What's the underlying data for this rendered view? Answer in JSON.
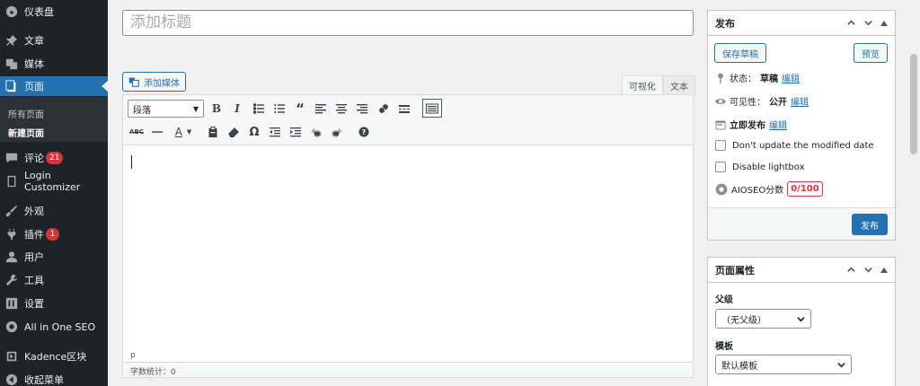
{
  "sidebar": {
    "items": [
      {
        "label": "仪表盘",
        "icon": "dashboard-icon"
      },
      {
        "label": "文章",
        "icon": "pin-icon"
      },
      {
        "label": "媒体",
        "icon": "media-icon"
      },
      {
        "label": "页面",
        "icon": "page-icon"
      },
      {
        "label": "评论",
        "icon": "comment-icon",
        "badge": "21"
      },
      {
        "label": "Login Customizer",
        "icon": "document-icon"
      },
      {
        "label": "外观",
        "icon": "appearance-icon"
      },
      {
        "label": "插件",
        "icon": "plugin-icon",
        "badge": "1"
      },
      {
        "label": "用户",
        "icon": "user-icon"
      },
      {
        "label": "工具",
        "icon": "wrench-icon"
      },
      {
        "label": "设置",
        "icon": "settings-icon"
      },
      {
        "label": "All in One SEO",
        "icon": "seo-icon"
      },
      {
        "label": "Kadence区块",
        "icon": "kadence-icon"
      },
      {
        "label": "收起菜单",
        "icon": "collapse-icon"
      }
    ],
    "submenu": [
      "所有页面",
      "新建页面"
    ],
    "accent": "#2271b1"
  },
  "editor": {
    "title_placeholder": "添加标题",
    "add_media_label": "添加媒体",
    "tab_visual": "可视化",
    "tab_text": "文本",
    "format_select": "段落",
    "status_path": "p",
    "word_count": "字数统计：0"
  },
  "publish": {
    "title": "发布",
    "save_draft": "保存草稿",
    "preview": "预览",
    "status_label": "状态：",
    "status_value": "草稿",
    "edit": "编辑",
    "visibility_label": "可见性：",
    "visibility_value": "公开",
    "schedule_label": "立即发布",
    "dont_update": "Don't update the modified date",
    "disable_lightbox": "Disable lightbox",
    "aioseo_label": "AIOSEO分数",
    "aioseo_score": "0/100",
    "publish_button": "发布"
  },
  "page_attributes": {
    "title": "页面属性",
    "parent_label": "父级",
    "parent_value": "（无父级）",
    "template_label": "模板",
    "template_value": "默认模板"
  }
}
